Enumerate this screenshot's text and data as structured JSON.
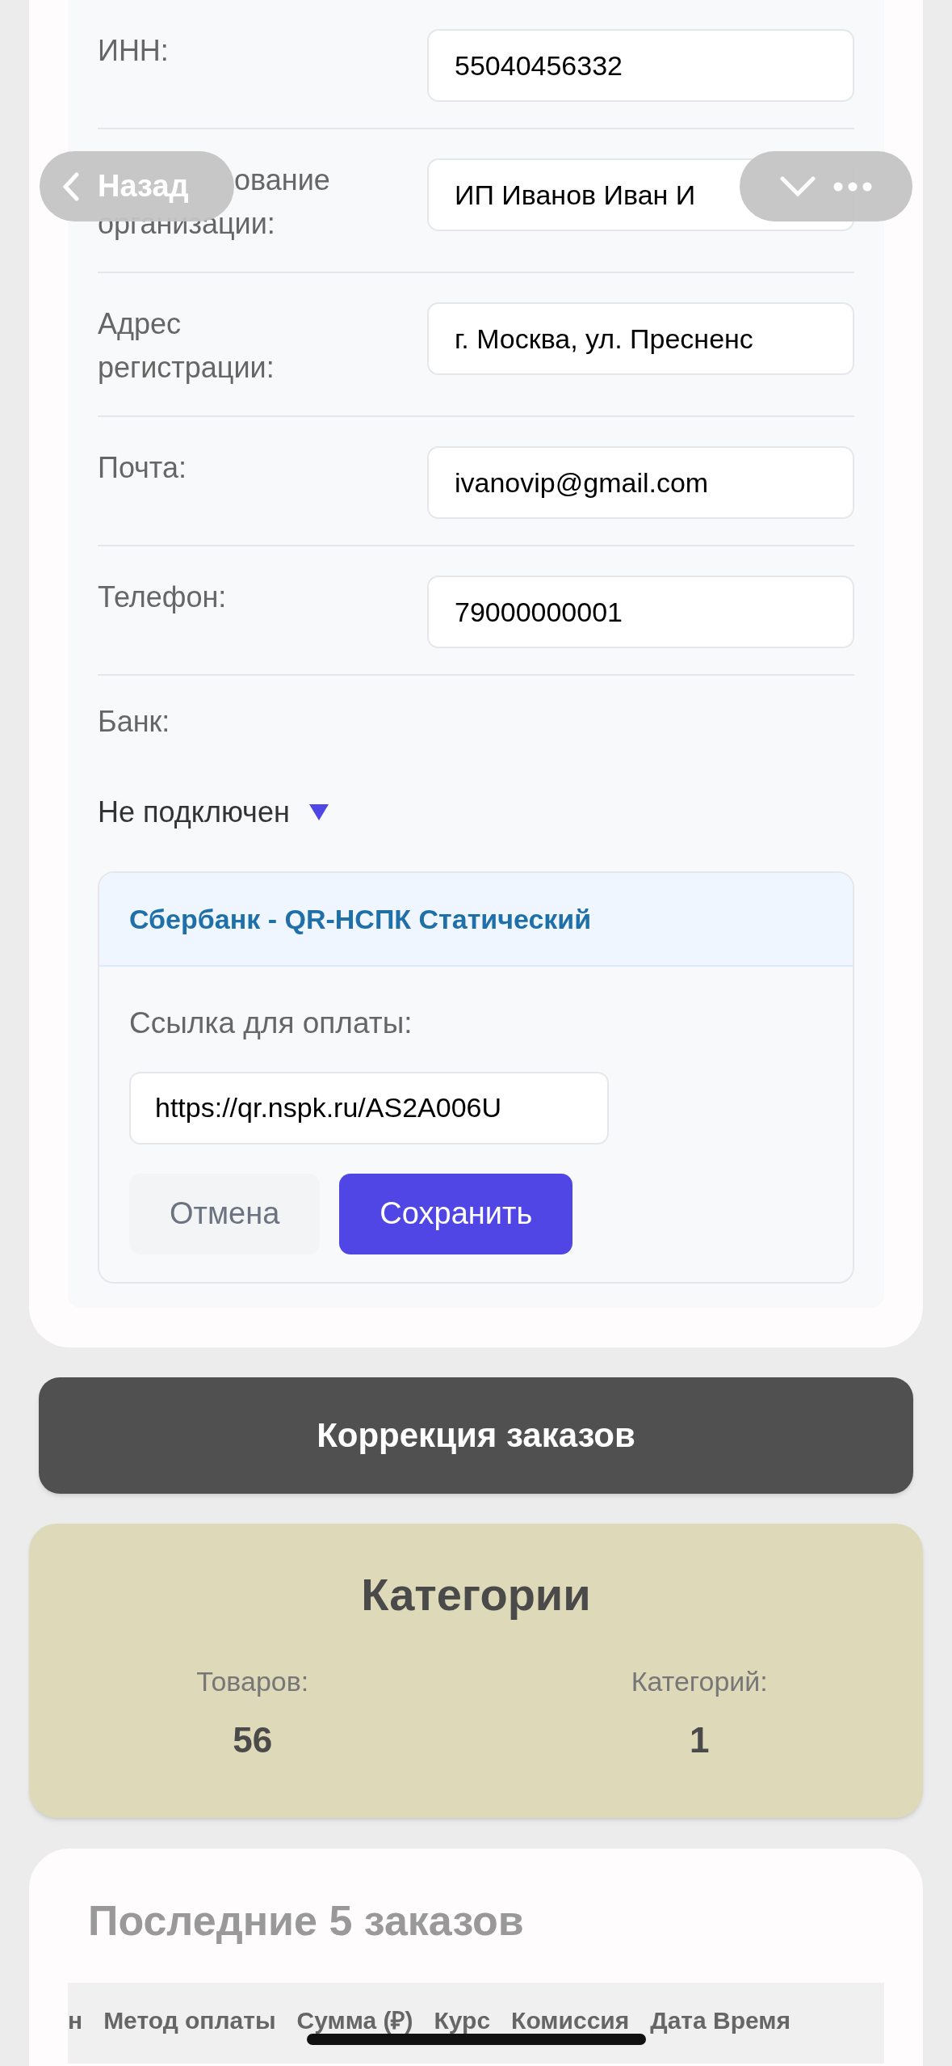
{
  "nav": {
    "back_label": "Назад"
  },
  "form_rows": [
    {
      "label_lines": [
        "ИНН:"
      ],
      "value": "55040456332"
    },
    {
      "label_lines": [
        "ование",
        "организации:"
      ],
      "value": "ИП Иванов Иван И",
      "covered": true
    },
    {
      "label_lines": [
        "Адрес",
        "регистрации:"
      ],
      "value": "г. Москва, ул. Пресненс"
    },
    {
      "label_lines": [
        "Почта:"
      ],
      "value": "ivanovip@gmail.com"
    },
    {
      "label_lines": [
        "Телефон:"
      ],
      "value": "79000000001"
    }
  ],
  "bank": {
    "label": "Банк:",
    "status": "Не подключен",
    "card": {
      "title": "Сбербанк - QR-НСПК Статический",
      "link_label": "Ссылка для оплаты:",
      "link_value": "https://qr.nspk.ru/AS2A006U",
      "buttons": [
        {
          "label": "Отмена",
          "kind": "secondary"
        },
        {
          "label": "Сохранить",
          "kind": "primary"
        }
      ]
    }
  },
  "correction_button": "Коррекция заказов",
  "categories": {
    "title": "Категории",
    "stats": [
      {
        "label": "Товаров:",
        "value": "56"
      },
      {
        "label": "Категорий:",
        "value": "1"
      }
    ]
  },
  "recent_orders": {
    "title": "Последние 5 заказов",
    "columns": [
      "н",
      "Метод оплаты",
      "Сумма (₽)",
      "Курс",
      "Комиссия",
      "Дата Время"
    ]
  }
}
